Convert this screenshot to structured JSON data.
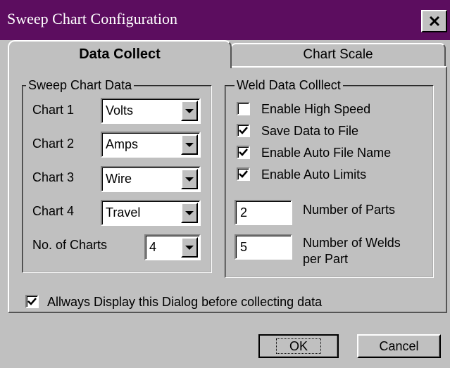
{
  "window": {
    "title": "Sweep Chart Configuration"
  },
  "tabs": {
    "data_collect": "Data Collect",
    "chart_scale": "Chart Scale"
  },
  "sweep_group": {
    "label": "Sweep Chart Data",
    "rows": [
      {
        "label": "Chart 1",
        "value": "Volts"
      },
      {
        "label": "Chart 2",
        "value": "Amps"
      },
      {
        "label": "Chart 3",
        "value": "Wire"
      },
      {
        "label": "Chart 4",
        "value": "Travel"
      }
    ],
    "num_charts_label": "No. of Charts",
    "num_charts_value": "4"
  },
  "weld_group": {
    "label": "Weld Data Colllect",
    "checkboxes": [
      {
        "label": "Enable High Speed",
        "checked": false
      },
      {
        "label": "Save Data to File",
        "checked": true
      },
      {
        "label": "Enable Auto File Name",
        "checked": true
      },
      {
        "label": "Enable Auto Limits",
        "checked": true
      }
    ],
    "num_parts_value": "2",
    "num_parts_label": "Number of Parts",
    "num_welds_value": "5",
    "num_welds_label_line1": "Number of Welds",
    "num_welds_label_line2": "per Part"
  },
  "always_display": {
    "label": "Allways Display this Dialog before collecting data",
    "checked": true
  },
  "buttons": {
    "ok": "OK",
    "cancel": "Cancel"
  },
  "colors": {
    "titlebar": "#5c0d5f",
    "face": "#c0c0c0"
  },
  "icons": {
    "close": "close-icon",
    "dropdown": "chevron-down-icon",
    "check": "checkmark-icon"
  }
}
